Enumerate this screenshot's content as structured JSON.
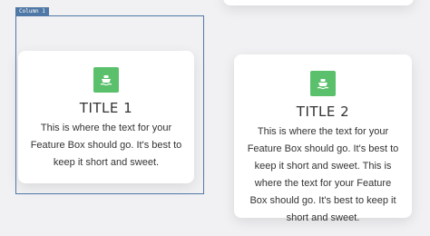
{
  "column": {
    "label": "Column 1"
  },
  "cards": [
    {
      "icon": "ship-icon",
      "title": "TITLE 1",
      "text": "This is where the text for your Feature Box should go. It's best to keep it short and sweet."
    },
    {
      "icon": "ship-icon",
      "title": "TITLE 2",
      "text": "This is where the text for your Feature Box should go. It's best to keep it short and sweet. This is where the text for your Feature Box should go. It's best to keep it short and sweet."
    }
  ],
  "colors": {
    "background": "#f1f1f3",
    "card": "#ffffff",
    "icon_bg": "#5bc06b",
    "column_outline": "#4f78a6"
  }
}
